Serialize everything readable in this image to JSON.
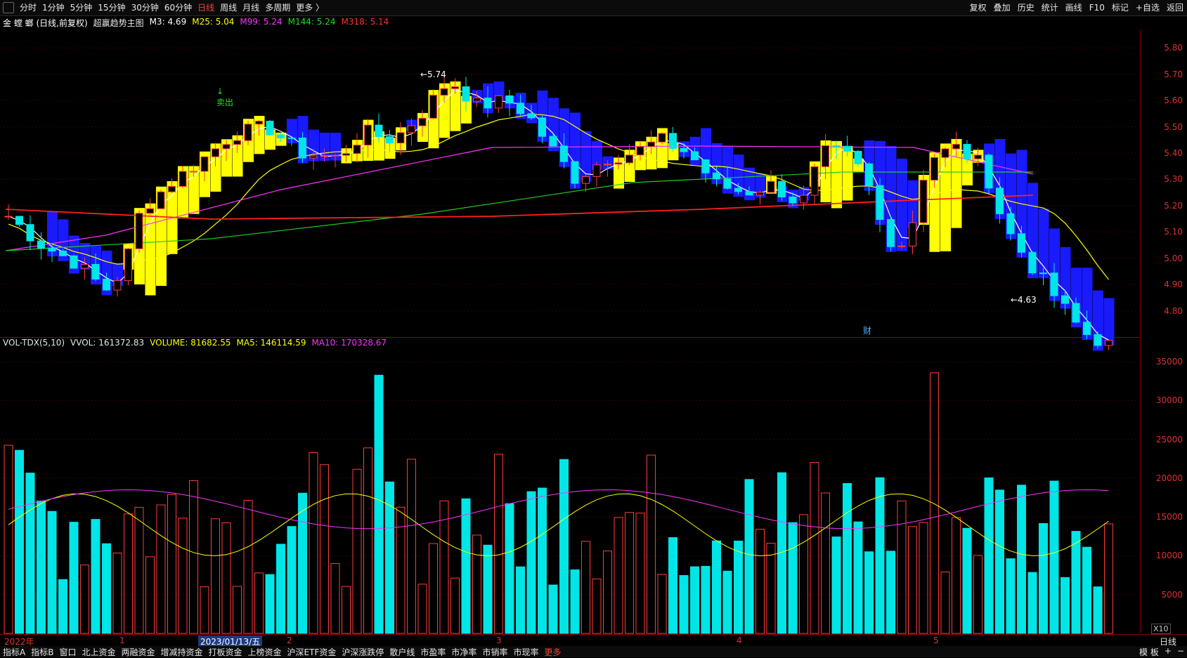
{
  "topbar": {
    "left_tabs": [
      "分时",
      "1分钟",
      "5分钟",
      "15分钟",
      "30分钟",
      "60分钟",
      "日线",
      "周线",
      "月线",
      "多周期",
      "更多 〉"
    ],
    "active_tab": "日线",
    "right_buttons": [
      "复权",
      "叠加",
      "历史",
      "统计",
      "画线",
      "F10",
      "标记",
      "+自选",
      "返回"
    ]
  },
  "price_legend": {
    "stock": "金 螳 螂 (日线,前复权)",
    "indicator": "超赢趋势主图",
    "m3": "M3: 4.69",
    "m25": "M25: 5.04",
    "m99": "M99: 5.24",
    "m144": "M144: 5.24",
    "m318": "M318: 5.14"
  },
  "price_annotations": {
    "high_label": "5.74",
    "low_label": "4.63",
    "sell_label": "卖出",
    "cai_label": "财"
  },
  "vol_legend": {
    "name": "VOL-TDX(5,10)",
    "vvol": "VVOL: 161372.83",
    "volume": "VOLUME: 81682.55",
    "ma5": "MA5: 146114.59",
    "ma10": "MA10: 170328.67"
  },
  "price_axis": [
    "5.80",
    "5.70",
    "5.60",
    "5.50",
    "5.40",
    "5.30",
    "5.20",
    "5.10",
    "5.00",
    "4.90",
    "4.80"
  ],
  "vol_axis": [
    "35000",
    "30000",
    "25000",
    "20000",
    "15000",
    "10000",
    "5000"
  ],
  "vol_axis_unit": "X10",
  "x_axis": {
    "year": "2022年",
    "m1": "1",
    "m2": "2",
    "m3": "3",
    "m4": "4",
    "m5": "5",
    "date_box": "2023/01/13/五",
    "right_label": "日线"
  },
  "bottombar": {
    "tabs": [
      "指标A",
      "指标B",
      "窗口",
      "北上资金",
      "两融资金",
      "增减持资金",
      "打板资金",
      "上榜资金",
      "沪深ETF资金",
      "沪深涨跌停",
      "散户线",
      "市盈率",
      "市净率",
      "市销率",
      "市现率",
      "更多"
    ],
    "right": [
      "模 板",
      "+",
      "−"
    ]
  },
  "colors": {
    "up": "#ff3c3c",
    "down": "#00e5e5",
    "ma_white": "#ffffff",
    "ma_yellow": "#ffff00",
    "ma_magenta": "#ff33ff",
    "ma_green": "#22cc22",
    "ma_red": "#ff2020",
    "band_yellow": "#ffff00",
    "band_blue": "#1a1aff"
  }
}
